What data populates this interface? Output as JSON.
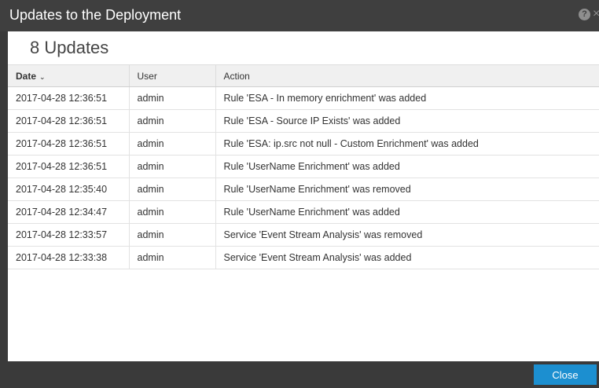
{
  "dialog": {
    "title": "Updates to the Deployment",
    "help_icon": "help-icon",
    "help_glyph": "?",
    "close_icon": "close-icon",
    "close_glyph": "×"
  },
  "summary": {
    "count_text": "8 Updates"
  },
  "table": {
    "columns": [
      {
        "label": "Date",
        "sort": "descending"
      },
      {
        "label": "User"
      },
      {
        "label": "Action"
      }
    ],
    "sort_indicator": "⌄",
    "rows": [
      {
        "date": "2017-04-28 12:36:51",
        "user": "admin",
        "action": "Rule 'ESA - In memory enrichment' was added"
      },
      {
        "date": "2017-04-28 12:36:51",
        "user": "admin",
        "action": "Rule 'ESA - Source IP Exists' was added"
      },
      {
        "date": "2017-04-28 12:36:51",
        "user": "admin",
        "action": "Rule 'ESA: ip.src not null - Custom Enrichment' was added"
      },
      {
        "date": "2017-04-28 12:36:51",
        "user": "admin",
        "action": "Rule 'UserName Enrichment' was added"
      },
      {
        "date": "2017-04-28 12:35:40",
        "user": "admin",
        "action": "Rule 'UserName Enrichment' was removed"
      },
      {
        "date": "2017-04-28 12:34:47",
        "user": "admin",
        "action": "Rule 'UserName Enrichment' was added"
      },
      {
        "date": "2017-04-28 12:33:57",
        "user": "admin",
        "action": "Service 'Event Stream Analysis' was removed"
      },
      {
        "date": "2017-04-28 12:33:38",
        "user": "admin",
        "action": "Service 'Event Stream Analysis' was added"
      }
    ]
  },
  "footer": {
    "close_label": "Close"
  },
  "colors": {
    "titlebar": "#3f3f3f",
    "accent": "#1c8fd0"
  }
}
